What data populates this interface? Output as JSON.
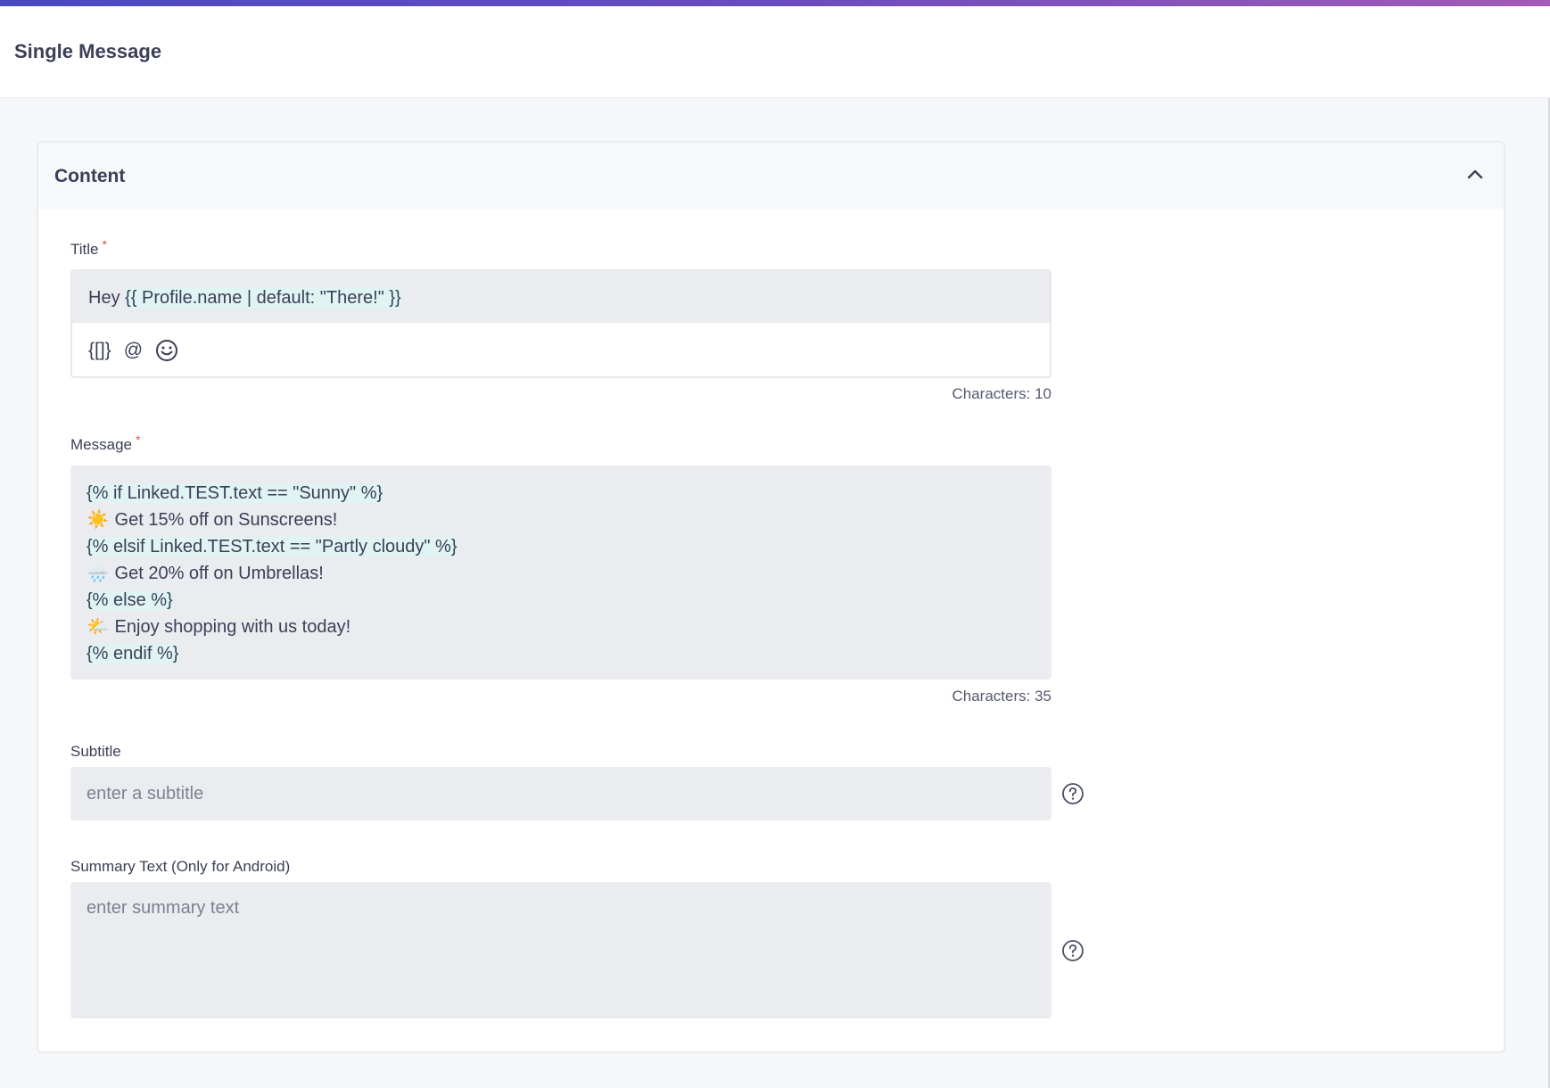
{
  "header": {
    "title": "Single Message"
  },
  "content_section": {
    "title": "Content",
    "collapse_icon": "chevron-up-icon",
    "title_field": {
      "label": "Title",
      "required_mark": "*",
      "value_prefix": "Hey ",
      "value_token": "{{ Profile.name | default: \"There!\" }}",
      "toolbar": {
        "personalize_label": "{[]}",
        "mention_label": "@",
        "emoji_icon": "smiley-icon"
      },
      "counter": "Characters: 10"
    },
    "message_field": {
      "label": "Message",
      "required_mark": "*",
      "lines": [
        {
          "emoji": "",
          "token": "{% if Linked.TEST.text == \"Sunny\" %}",
          "text": ""
        },
        {
          "emoji": "☀️",
          "token": "",
          "text": " Get 15% off on Sunscreens!"
        },
        {
          "emoji": "",
          "token": "{% elsif Linked.TEST.text == \"Partly cloudy\" %}",
          "text": ""
        },
        {
          "emoji": "🌧️",
          "token": "",
          "text": " Get 20% off on Umbrellas!"
        },
        {
          "emoji": "",
          "token": "{% else %}",
          "text": ""
        },
        {
          "emoji": "🌤️",
          "token": "",
          "text": " Enjoy shopping with us today!"
        },
        {
          "emoji": "",
          "token": "{% endif %}",
          "text": ""
        }
      ],
      "counter": "Characters: 35"
    },
    "subtitle_field": {
      "label": "Subtitle",
      "placeholder": "enter a subtitle",
      "help_icon": "question-circle-icon"
    },
    "summary_field": {
      "label": "Summary Text (Only for Android)",
      "placeholder": "enter summary text",
      "help_icon": "question-circle-icon"
    }
  },
  "colors": {
    "accent_gradient_start": "#4a49c4",
    "accent_gradient_end": "#a35bb5",
    "required": "#e5534b",
    "token_highlight": "#e0f4f3",
    "field_bg": "#ebecf0"
  }
}
